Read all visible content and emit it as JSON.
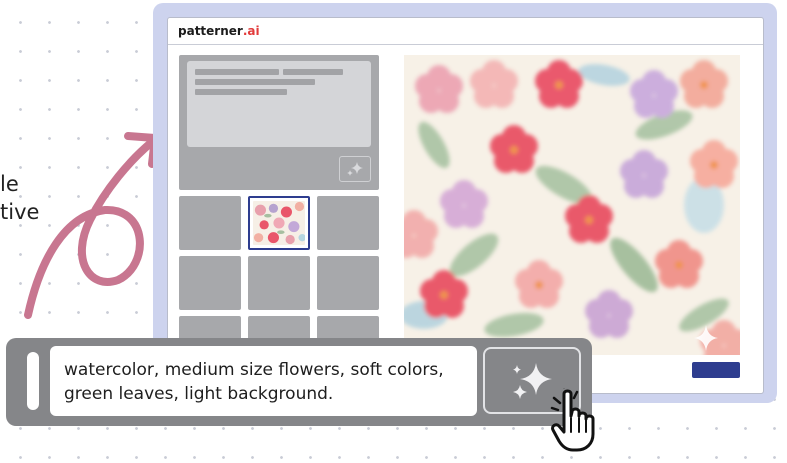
{
  "side_text": [
    "le",
    "tive"
  ],
  "app": {
    "brand_name": "patterner",
    "brand_suffix": ".ai",
    "brand_suffix_color": "#e23b3b",
    "accent_color": "#2e3d8f"
  },
  "prompt": {
    "line1": "watercolor, medium size flowers, soft colors,",
    "line2": "green leaves, light background."
  },
  "icons": {
    "generate": "sparkles-icon",
    "panel_generate": "sparkles-icon",
    "cursor": "hand-pointer-icon",
    "arrow": "curly-arrow-icon"
  },
  "colors": {
    "frame": "#cdd3ee",
    "panel_gray": "#a7a8ab",
    "prompt_bar": "#858689",
    "arrow": "#c87690"
  }
}
